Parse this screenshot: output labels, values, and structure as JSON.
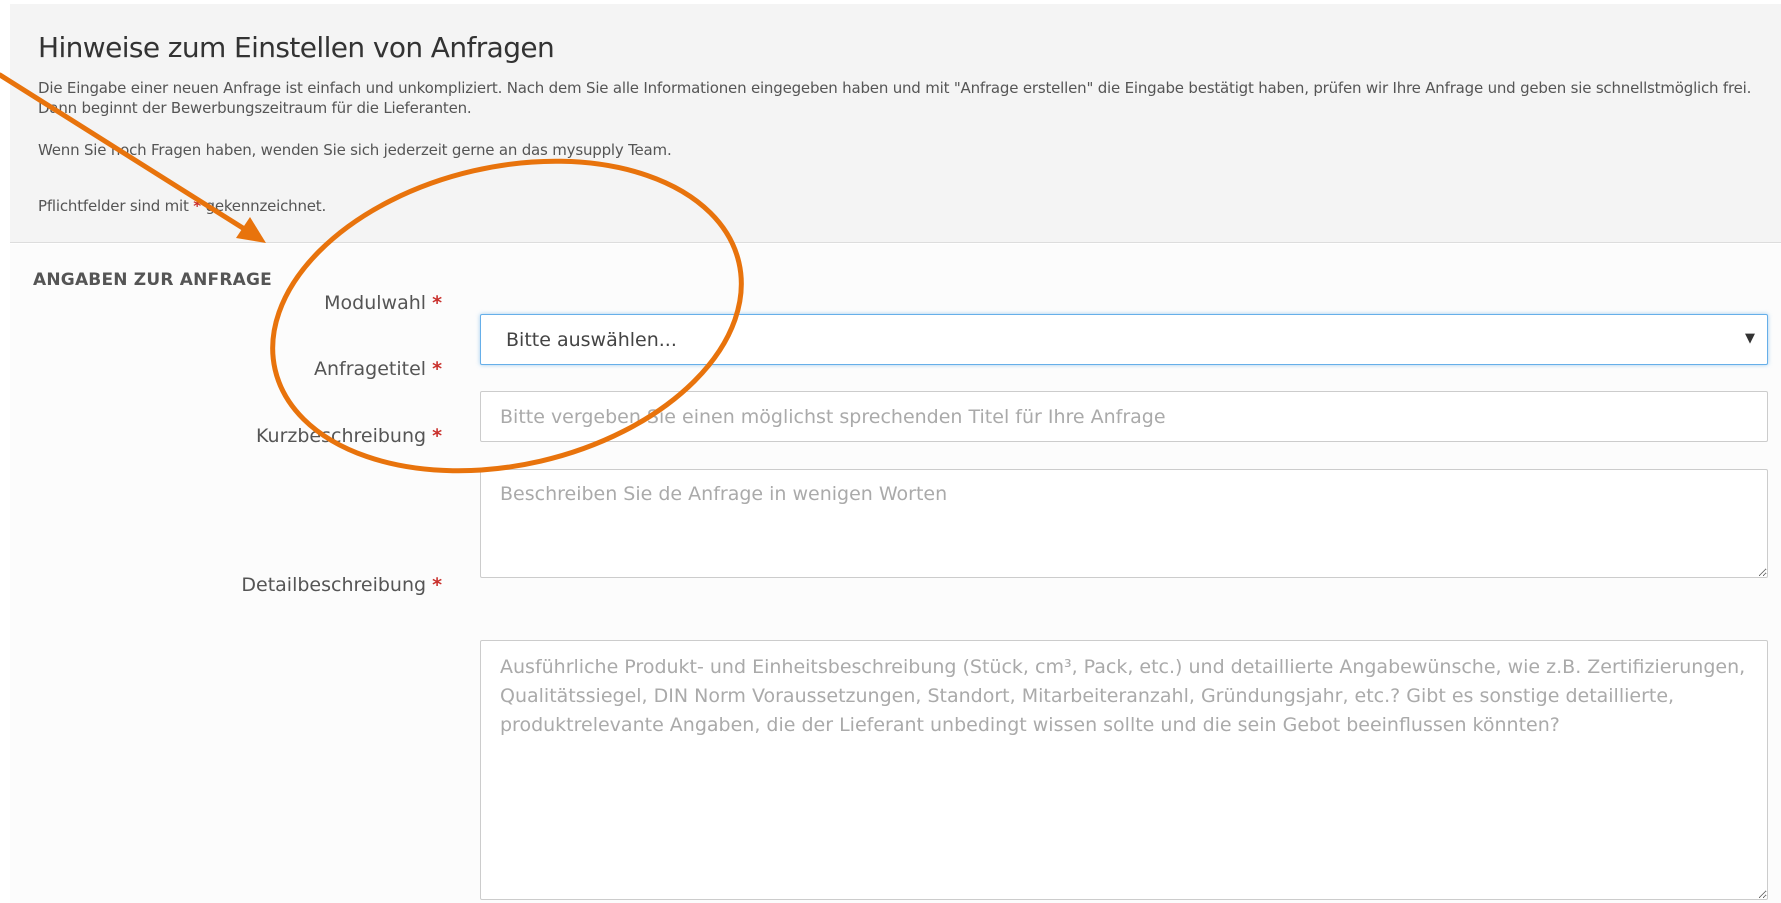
{
  "hints": {
    "title": "Hinweise zum Einstellen von Anfragen",
    "intro": "Die Eingabe einer neuen Anfrage ist einfach und unkompliziert. Nach dem Sie alle Informationen eingegeben haben und mit \"Anfrage erstellen\" die Eingabe bestätigt haben, prüfen wir Ihre Anfrage und geben sie schnellstmöglich frei. Dann beginnt der Bewerbungszeitraum für die Lieferanten.",
    "contact": "Wenn Sie noch Fragen haben, wenden Sie sich jederzeit gerne an das mysupply Team.",
    "required_prefix": "Pflichtfelder sind mit ",
    "required_marker": "*",
    "required_suffix": " gekennzeichnet."
  },
  "section": {
    "title": "ANGABEN ZUR ANFRAGE"
  },
  "form": {
    "required_marker": "*",
    "module": {
      "label": "Modulwahl",
      "value": "Bitte auswählen...",
      "caret": "▼"
    },
    "title": {
      "label": "Anfragetitel",
      "placeholder": "Bitte vergeben Sie einen möglichst sprechenden Titel für Ihre Anfrage"
    },
    "short_description": {
      "label": "Kurzbeschreibung",
      "placeholder": "Beschreiben Sie de Anfrage in wenigen Worten"
    },
    "detail_description": {
      "label": "Detailbeschreibung",
      "placeholder": "Ausführliche Produkt- und Einheitsbeschreibung (Stück, cm³, Pack, etc.) und detaillierte Angabewünsche, wie z.B. Zertifizierungen, Qualitätssiegel, DIN Norm Voraussetzungen, Standort, Mitarbeiteranzahl, Gründungsjahr, etc.? Gibt es sonstige detaillierte, produktrelevante Angaben, die der Lieferant unbedingt wissen sollte und die sein Gebot beeinflussen könnten?"
    }
  },
  "colors": {
    "annotation": "#e8730c",
    "required": "#c9302c",
    "focus_border": "#66afe9",
    "hint_background": "#f4f4f4"
  }
}
